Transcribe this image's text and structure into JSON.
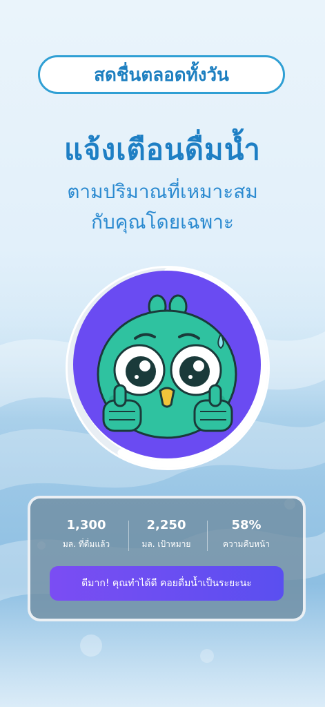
{
  "tagline": "สดชื่นตลอดทั้งวัน",
  "headline": "แจ้งเตือนดื่มน้ำ",
  "subheadline_line1": "ตามปริมาณที่เหมาะสม",
  "subheadline_line2": "กับคุณโดยเฉพาะ",
  "mascot_icon": "owl-mascot-thumbs-up-icon",
  "progress_percent": 58,
  "stats": [
    {
      "value": "1,300",
      "label": "มล. ที่ดื่มแล้ว"
    },
    {
      "value": "2,250",
      "label": "มล. เป้าหมาย"
    },
    {
      "value": "58%",
      "label": "ความคืบหน้า"
    }
  ],
  "cta_label": "ดีมาก! คุณทำได้ดี คอยดื่มน้ำเป็นระยะนะ",
  "colors": {
    "accent": "#1e7fc4",
    "avatar_bg": "#6a4bf2",
    "mascot": "#2fc2a0",
    "cta_start": "#7b4df3",
    "cta_end": "#5a4ff0"
  }
}
